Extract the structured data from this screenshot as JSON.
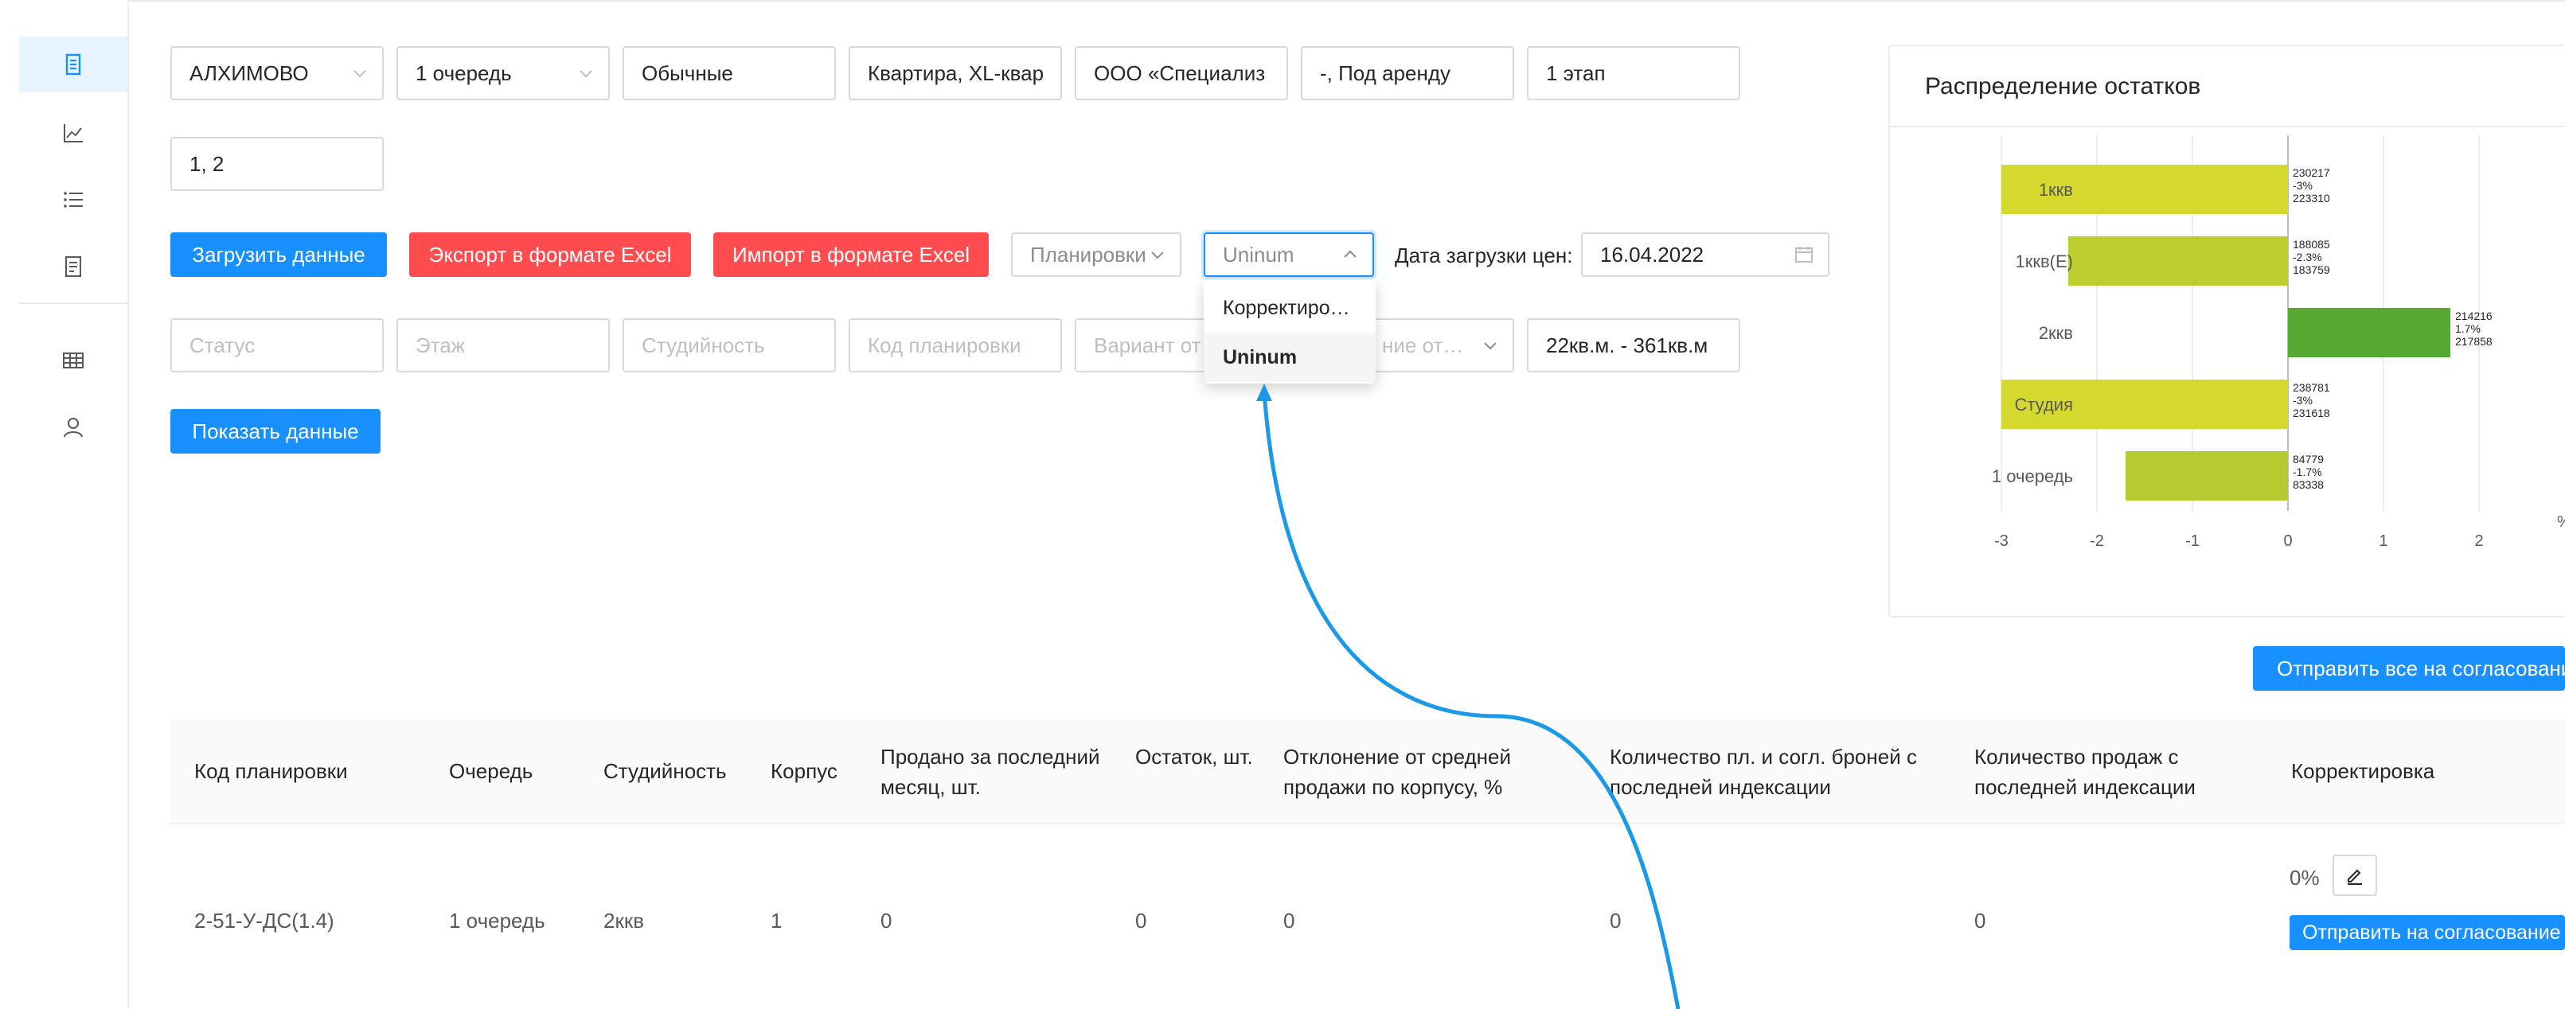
{
  "filters": {
    "row1": [
      {
        "value": "АЛХИМОВО",
        "has_chevron": true
      },
      {
        "value": "1 очередь",
        "has_chevron": true
      },
      {
        "value": "Обычные"
      },
      {
        "value": "Квартира, XL-квар"
      },
      {
        "value": "ООО «Специализ"
      },
      {
        "value": "-, Под аренду"
      },
      {
        "value": "1 этап"
      }
    ],
    "row2_value": "1, 2"
  },
  "buttons": {
    "load_data": "Загрузить данные",
    "export_excel": "Экспорт в формате Excel",
    "import_excel": "Импорт в формате Excel",
    "show_data": "Показать данные",
    "send_all": "Отправить все на согласование",
    "send_one": "Отправить на согласование"
  },
  "toolbar": {
    "layouts_select": "Планировки",
    "source_select": "Uninum",
    "date_label": "Дата загрузки цен:",
    "date_value": "16.04.2022"
  },
  "dropdown": {
    "options": [
      {
        "label": "Корректиро…",
        "selected": false
      },
      {
        "label": "Uninum",
        "selected": true
      }
    ]
  },
  "search_row": {
    "placeholders": [
      "Статус",
      "Этаж",
      "Студийность",
      "Код планировки",
      "Вариант от",
      "ние от…"
    ],
    "area_value": "22кв.м. - 361кв.м"
  },
  "card": {
    "title": "Распределение остатков"
  },
  "chart_data": {
    "type": "bar",
    "orientation": "horizontal",
    "categories": [
      "1ккв",
      "1ккв(Е)",
      "2ккв",
      "Студия",
      "1 очередь"
    ],
    "values": [
      -3,
      -2.3,
      1.7,
      -3,
      -1.7
    ],
    "labels": [
      [
        "230217",
        "-3%",
        "223310"
      ],
      [
        "188085",
        "-2.3%",
        "183759"
      ],
      [
        "214216",
        "1.7%",
        "217858"
      ],
      [
        "238781",
        "-3%",
        "231618"
      ],
      [
        "84779",
        "-1.7%",
        "83338"
      ]
    ],
    "bar_colors": [
      "#d5d92e",
      "#bcce2f",
      "#55a832",
      "#d5d92e",
      "#b5cb2f"
    ],
    "xticks": [
      "-3",
      "-2",
      "-1",
      "0",
      "1",
      "2"
    ],
    "xlim": [
      -3,
      2
    ],
    "xunit": "%",
    "grid": true
  },
  "table": {
    "headers": [
      "Код планировки",
      "Очередь",
      "Студийность",
      "Корпус",
      "Продано за последний месяц, шт.",
      "Остаток, шт.",
      "Отклонение от средней продажи по корпусу, %",
      "Количество пл. и согл. броней с последней индексации",
      "Количество продаж с последней индексации",
      "Корректировка"
    ],
    "rows": [
      {
        "cells": [
          "2-51-У-ДС(1.4)",
          "1 очередь",
          "2ккв",
          "1",
          "0",
          "0",
          "0",
          "0",
          "0"
        ],
        "correction": "0%"
      }
    ]
  },
  "colors": {
    "primary": "#1890ff",
    "danger": "#ff4d4f",
    "annotation_arrow": "#1a9ae6"
  }
}
